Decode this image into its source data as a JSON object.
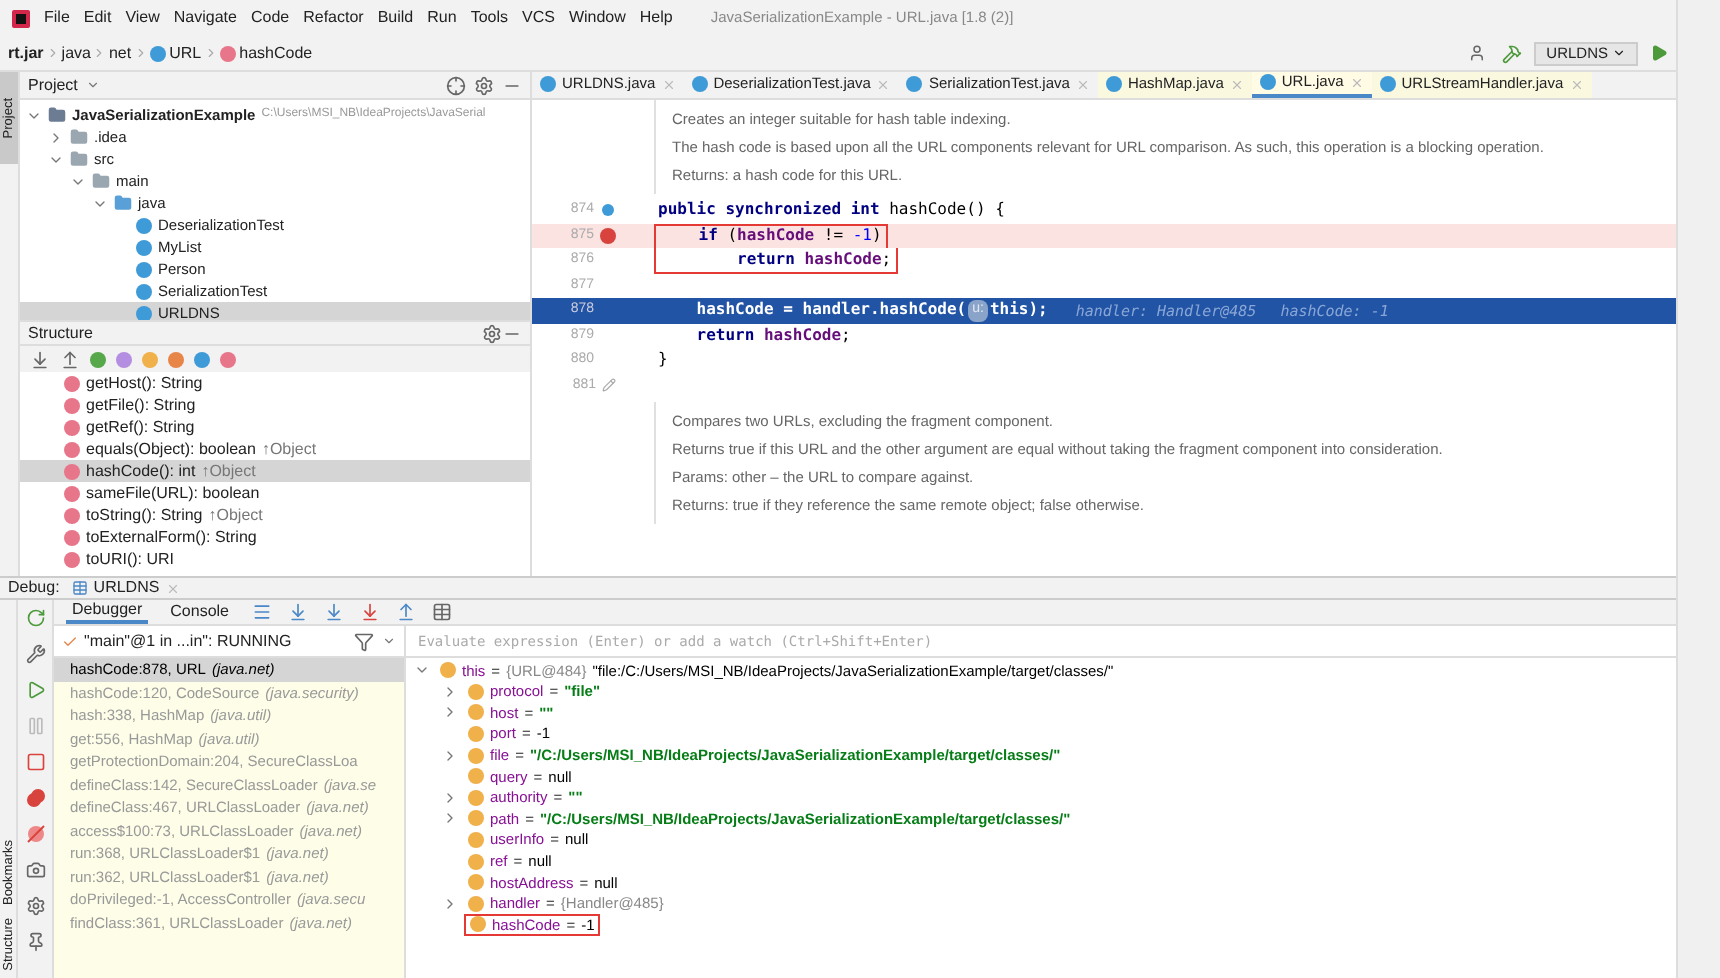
{
  "menu": [
    "File",
    "Edit",
    "View",
    "Navigate",
    "Code",
    "Refactor",
    "Build",
    "Run",
    "Tools",
    "VCS",
    "Window",
    "Help"
  ],
  "window": {
    "title": "JavaSerializationExample - URL.java [1.8 (2)]"
  },
  "breadcrumb": [
    {
      "label": "rt.jar",
      "kind": "jar"
    },
    {
      "label": "java",
      "kind": "package"
    },
    {
      "label": "net",
      "kind": "package"
    },
    {
      "label": "URL",
      "kind": "class"
    },
    {
      "label": "hashCode",
      "kind": "method"
    }
  ],
  "run_config": {
    "label": "URLDNS"
  },
  "side_tab": {
    "label": "Project",
    "selected": true
  },
  "project": {
    "title": "Project",
    "tree": [
      {
        "label": "JavaSerializationExample",
        "kind": "module",
        "hint": "C:\\Users\\MSI_NB\\IdeaProjects\\JavaSerial",
        "expanded": true,
        "selected": false,
        "children": [
          {
            "label": ".idea",
            "kind": "folder",
            "expanded": false,
            "selected": false
          },
          {
            "label": "src",
            "kind": "folder",
            "expanded": true,
            "selected": false,
            "children": [
              {
                "label": "main",
                "kind": "folder",
                "expanded": true,
                "selected": false,
                "children": [
                  {
                    "label": "java",
                    "kind": "source-folder",
                    "expanded": true,
                    "selected": false,
                    "children": [
                      {
                        "label": "DeserializationTest",
                        "kind": "class",
                        "selected": false
                      },
                      {
                        "label": "MyList",
                        "kind": "class",
                        "selected": false
                      },
                      {
                        "label": "Person",
                        "kind": "class",
                        "selected": false
                      },
                      {
                        "label": "SerializationTest",
                        "kind": "class",
                        "selected": false
                      },
                      {
                        "label": "URLDNS",
                        "kind": "class",
                        "selected": true
                      }
                    ]
                  }
                ]
              }
            ]
          }
        ]
      }
    ]
  },
  "structure": {
    "title": "Structure",
    "items": [
      {
        "label": "getHost(): String",
        "selected": false
      },
      {
        "label": "getFile(): String",
        "selected": false
      },
      {
        "label": "getRef(): String",
        "selected": false
      },
      {
        "label": "equals(Object): boolean",
        "inherited": "↑Object",
        "selected": false
      },
      {
        "label": "hashCode(): int",
        "inherited": "↑Object",
        "selected": true
      },
      {
        "label": "sameFile(URL): boolean",
        "selected": false
      },
      {
        "label": "toString(): String",
        "inherited": "↑Object",
        "selected": false
      },
      {
        "label": "toExternalForm(): String",
        "selected": false
      },
      {
        "label": "toURI(): URI",
        "selected": false
      }
    ]
  },
  "editor_tabs": [
    {
      "label": "URLDNS.java",
      "selected": false
    },
    {
      "label": "DeserializationTest.java",
      "selected": false
    },
    {
      "label": "SerializationTest.java",
      "selected": false
    },
    {
      "label": "HashMap.java",
      "selected": false
    },
    {
      "label": "URL.java",
      "selected": true
    },
    {
      "label": "URLStreamHandler.java",
      "selected": false
    }
  ],
  "editor": [
    {
      "kind": "doc",
      "paragraphs": [
        "Creates an integer suitable for hash table indexing.",
        "The hash code is based upon all the URL components relevant for URL comparison. As such, this operation is a blocking operation.",
        "Returns: a hash code for this URL."
      ]
    },
    {
      "kind": "code",
      "lines": [
        {
          "number": "874",
          "kind": "override",
          "current": false,
          "boxed": false,
          "tokens": [
            {
              "text": "public synchronized int ",
              "kind": "keyword"
            },
            {
              "text": "hashCode() {",
              "kind": "plain"
            }
          ]
        },
        {
          "number": "875",
          "kind": "breakpoint",
          "current": false,
          "boxed": true,
          "tokens": [
            {
              "text": "    if ",
              "kind": "keyword"
            },
            {
              "text": "(",
              "kind": "plain"
            },
            {
              "text": "hashCode",
              "kind": "field"
            },
            {
              "text": " != ",
              "kind": "plain"
            },
            {
              "text": "-1",
              "kind": "number"
            },
            {
              "text": ")",
              "kind": "plain"
            }
          ]
        },
        {
          "number": "876",
          "kind": "plain",
          "current": false,
          "boxed": true,
          "tokens": [
            {
              "text": "        return ",
              "kind": "keyword"
            },
            {
              "text": "hashCode",
              "kind": "field"
            },
            {
              "text": ";",
              "kind": "plain"
            }
          ]
        },
        {
          "number": "877",
          "kind": "plain",
          "current": false,
          "boxed": false
        },
        {
          "number": "878",
          "kind": "plain",
          "current": true,
          "boxed": false,
          "tokens": [
            {
              "text": "    hashCode",
              "kind": "field"
            },
            {
              "text": " = handler.hashCode(",
              "kind": "plain"
            },
            {
              "text": "u:",
              "kind": "param-hint"
            },
            {
              "text": "this",
              "kind": "keyword"
            },
            {
              "text": ");",
              "kind": "plain"
            }
          ],
          "hints": [
            "handler: Handler@485",
            "hashCode: -1"
          ]
        },
        {
          "number": "879",
          "kind": "plain",
          "current": false,
          "boxed": false,
          "tokens": [
            {
              "text": "    return ",
              "kind": "keyword"
            },
            {
              "text": "hashCode",
              "kind": "field"
            },
            {
              "text": ";",
              "kind": "plain"
            }
          ]
        },
        {
          "number": "880",
          "kind": "plain",
          "current": false,
          "boxed": false,
          "tokens": [
            {
              "text": "}",
              "kind": "plain"
            }
          ]
        },
        {
          "number": "881",
          "kind": "edit",
          "current": false,
          "boxed": false
        }
      ]
    },
    {
      "kind": "doc",
      "paragraphs": [
        "Compares two URLs, excluding the fragment component.",
        "Returns true if this URL and the other argument are equal without taking the fragment component into consideration.",
        "Params: other – the URL to compare against.",
        "Returns: true if they reference the same remote object; false otherwise."
      ]
    }
  ],
  "debug": {
    "title": "Debug:",
    "session": "URLDNS",
    "tabs": [
      {
        "label": "Debugger",
        "selected": true
      },
      {
        "label": "Console",
        "selected": false
      }
    ],
    "thread": "\"main\"@1 in ...in\": RUNNING",
    "evaluate": {
      "placeholder": "Evaluate expression (Enter) or add a watch (Ctrl+Shift+Enter)"
    },
    "side_tabs": [
      "Bookmarks",
      "Structure"
    ],
    "frames": [
      {
        "method": "hashCode:878, URL",
        "package": "(java.net)",
        "selected": true
      },
      {
        "method": "hashCode:120, CodeSource",
        "package": "(java.security)",
        "selected": false
      },
      {
        "method": "hash:338, HashMap",
        "package": "(java.util)",
        "selected": false
      },
      {
        "method": "get:556, HashMap",
        "package": "(java.util)",
        "selected": false
      },
      {
        "method": "getProtectionDomain:204, SecureClassLoa",
        "selected": false
      },
      {
        "method": "defineClass:142, SecureClassLoader",
        "package": "(java.se",
        "selected": false
      },
      {
        "method": "defineClass:467, URLClassLoader",
        "package": "(java.net)",
        "selected": false
      },
      {
        "method": "access$100:73, URLClassLoader",
        "package": "(java.net)",
        "selected": false
      },
      {
        "method": "run:368, URLClassLoader$1",
        "package": "(java.net)",
        "selected": false
      },
      {
        "method": "run:362, URLClassLoader$1",
        "package": "(java.net)",
        "selected": false
      },
      {
        "method": "doPrivileged:-1, AccessController",
        "package": "(java.secu",
        "selected": false
      },
      {
        "method": "findClass:361, URLClassLoader",
        "package": "(java.net)",
        "selected": false
      }
    ],
    "variables": [
      {
        "name": "this",
        "sep": "=",
        "ref": "{URL@484}",
        "value": {
          "text": "\"file:/C:/Users/MSI_NB/IdeaProjects/JavaSerializationExample/target/classes/\"",
          "kind": "plain"
        },
        "kind": "object",
        "expanded": true,
        "boxed": false,
        "children": [
          {
            "name": "protocol",
            "sep": "=",
            "value": {
              "text": "\"file\"",
              "kind": "string"
            },
            "kind": "field",
            "expanded": false,
            "boxed": false
          },
          {
            "name": "host",
            "sep": "=",
            "value": {
              "text": "\"\"",
              "kind": "string"
            },
            "kind": "field",
            "expanded": false,
            "boxed": false
          },
          {
            "name": "port",
            "sep": "=",
            "value": {
              "text": "-1",
              "kind": "plain"
            },
            "kind": "field",
            "boxed": false
          },
          {
            "name": "file",
            "sep": "=",
            "value": {
              "text": "\"/C:/Users/MSI_NB/IdeaProjects/JavaSerializationExample/target/classes/\"",
              "kind": "string"
            },
            "kind": "field",
            "expanded": false,
            "boxed": false
          },
          {
            "name": "query",
            "sep": "=",
            "value": {
              "text": "null",
              "kind": "plain"
            },
            "kind": "field",
            "boxed": false
          },
          {
            "name": "authority",
            "sep": "=",
            "value": {
              "text": "\"\"",
              "kind": "string"
            },
            "kind": "field",
            "expanded": false,
            "boxed": false
          },
          {
            "name": "path",
            "sep": "=",
            "value": {
              "text": "\"/C:/Users/MSI_NB/IdeaProjects/JavaSerializationExample/target/classes/\"",
              "kind": "string"
            },
            "kind": "field",
            "expanded": false,
            "boxed": false
          },
          {
            "name": "userInfo",
            "sep": "=",
            "value": {
              "text": "null",
              "kind": "plain"
            },
            "kind": "field",
            "boxed": false
          },
          {
            "name": "ref",
            "sep": "=",
            "value": {
              "text": "null",
              "kind": "plain"
            },
            "kind": "field",
            "boxed": false
          },
          {
            "name": "hostAddress",
            "sep": "=",
            "value": {
              "text": "null",
              "kind": "plain"
            },
            "kind": "field",
            "boxed": false
          },
          {
            "name": "handler",
            "sep": "=",
            "ref": "{Handler@485}",
            "kind": "field",
            "expanded": false,
            "boxed": false
          },
          {
            "name": "hashCode",
            "sep": "=",
            "value": {
              "text": "-1",
              "kind": "plain"
            },
            "kind": "field",
            "boxed": true
          }
        ]
      }
    ]
  }
}
